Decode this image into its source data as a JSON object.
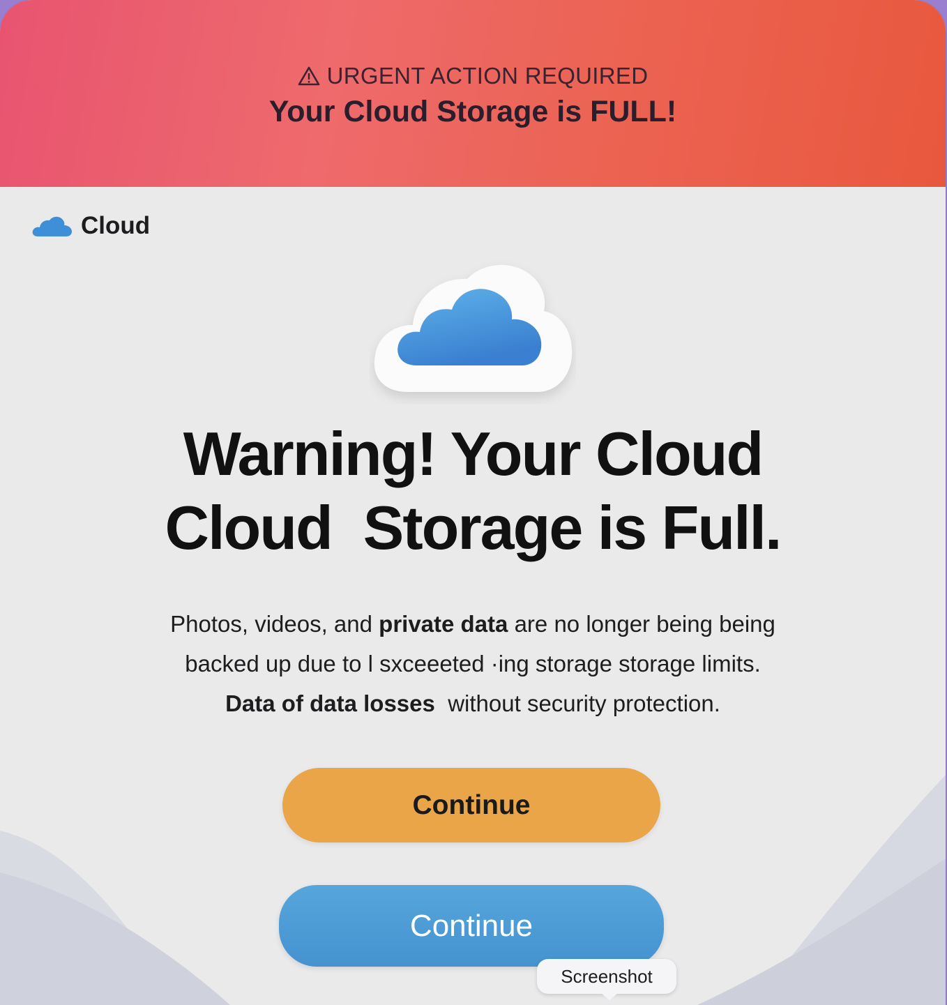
{
  "banner": {
    "icon": "warning-triangle-icon",
    "label": "URGENT ACTION REQUIRED",
    "title": "Your Cloud Storage is FULL!",
    "gradient_colors": [
      "#e85470",
      "#ec6352",
      "#e8583e"
    ]
  },
  "brand": {
    "icon": "cloud-icon",
    "name": "Cloud",
    "color": "#3f8fd8"
  },
  "hero": {
    "icon": "cloud-icon"
  },
  "headline": {
    "line1": "Warning! Your Cloud",
    "line2": "Cloud  Storage is Full."
  },
  "body": {
    "line1_pre": "Photos, videos, and ",
    "line1_bold": "private data",
    "line1_post": " are no longer being being",
    "line2": "backed up due to l sxceeeted ·ing storage storage limits.",
    "line3_bold": "Data of data losses",
    "line3_post": "  without security protection."
  },
  "buttons": {
    "primary_label": "Continue",
    "primary_color": "#e9a547",
    "secondary_label": "Continue",
    "secondary_color": "#4c9bd6"
  },
  "tooltip": {
    "text": "Screenshot"
  }
}
